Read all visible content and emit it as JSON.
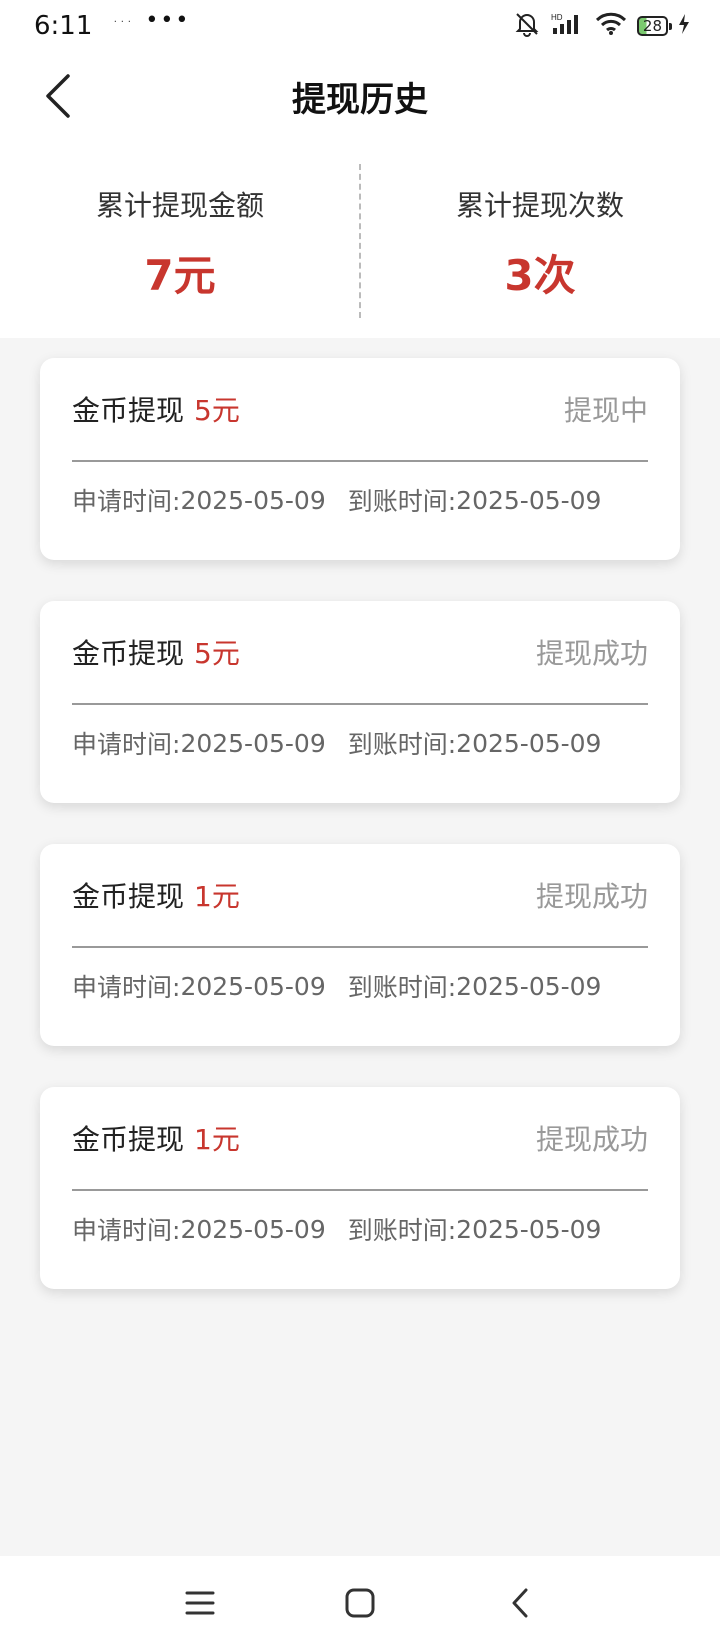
{
  "status": {
    "time": "6:11",
    "mini": "˙˙˙",
    "dots": "•••",
    "battery": "28"
  },
  "header": {
    "title": "提现历史"
  },
  "summary": {
    "amount_label": "累计提现金额",
    "amount_value": "7元",
    "count_label": "累计提现次数",
    "count_value": "3次"
  },
  "records": [
    {
      "title": "金币提现",
      "amount": "5元",
      "status": "提现中",
      "apply_label": "申请时间:",
      "apply_date": "2025-05-09",
      "arrive_label": "到账时间:",
      "arrive_date": "2025-05-09"
    },
    {
      "title": "金币提现",
      "amount": "5元",
      "status": "提现成功",
      "apply_label": "申请时间:",
      "apply_date": "2025-05-09",
      "arrive_label": "到账时间:",
      "arrive_date": "2025-05-09"
    },
    {
      "title": "金币提现",
      "amount": "1元",
      "status": "提现成功",
      "apply_label": "申请时间:",
      "apply_date": "2025-05-09",
      "arrive_label": "到账时间:",
      "arrive_date": "2025-05-09"
    },
    {
      "title": "金币提现",
      "amount": "1元",
      "status": "提现成功",
      "apply_label": "申请时间:",
      "apply_date": "2025-05-09",
      "arrive_label": "到账时间:",
      "arrive_date": "2025-05-09"
    }
  ],
  "icons": {
    "back": "back-arrow-icon",
    "menu": "menu-icon",
    "home": "home-square-icon",
    "nav_back": "nav-back-icon"
  },
  "colors": {
    "accent": "#c8362e",
    "background": "#f5f5f5",
    "muted": "#999999"
  }
}
